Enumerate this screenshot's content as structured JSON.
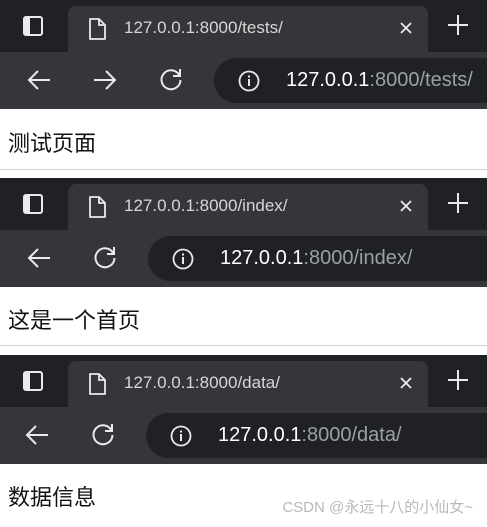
{
  "windows": [
    {
      "tab_title": "127.0.0.1:8000/tests/",
      "url_host": "127.0.0.1",
      "url_rest": ":8000/tests/",
      "has_forward": true,
      "page_text": "测试页面"
    },
    {
      "tab_title": "127.0.0.1:8000/index/",
      "url_host": "127.0.0.1",
      "url_rest": ":8000/index/",
      "has_forward": false,
      "page_text": "这是一个首页"
    },
    {
      "tab_title": "127.0.0.1:8000/data/",
      "url_host": "127.0.0.1",
      "url_rest": ":8000/data/",
      "has_forward": false,
      "page_text": "数据信息"
    }
  ],
  "watermark": "CSDN @永远十八的小仙女~",
  "icons": [
    "tab-actions-icon",
    "page-icon",
    "close-icon",
    "plus-icon",
    "back-arrow-icon",
    "forward-arrow-icon",
    "reload-icon",
    "info-icon"
  ],
  "colors": {
    "tabstrip": "#202124",
    "toolbar": "#35363a",
    "omnibox": "#202124"
  }
}
